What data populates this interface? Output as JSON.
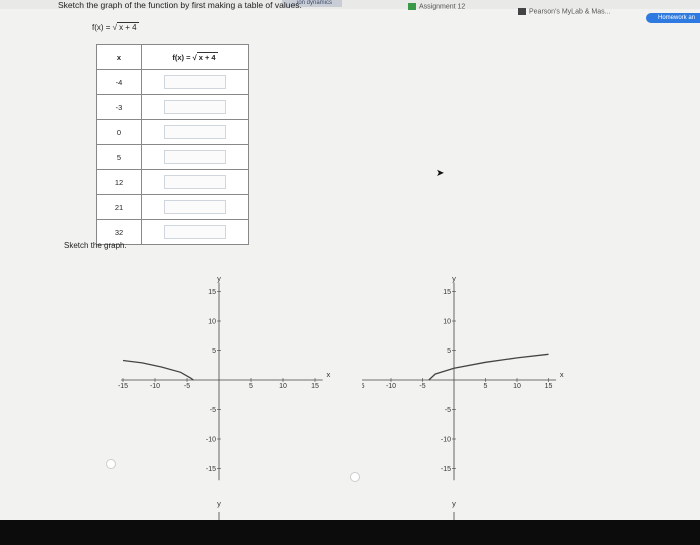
{
  "browser": {
    "tab_fragment": "...ion dynamics",
    "assignment_tab": "Assignment 12",
    "pearson_tab": "Pearson's MyLab & Mas...",
    "homework_tab": "Homework an"
  },
  "question": {
    "title": "Sketch the graph of the function by first making a table of values.",
    "function_lhs": "f(x) = ",
    "function_radicand": "x + 4"
  },
  "table": {
    "headers": {
      "x": "x",
      "fx_lhs": "f(x) = ",
      "fx_radicand": "x + 4"
    },
    "x_values": [
      "-4",
      "-3",
      "0",
      "5",
      "12",
      "21",
      "32"
    ]
  },
  "sketch_label": "Sketch the graph.",
  "graphs": [
    {
      "x_label": "x",
      "y_label": "y",
      "x_ticks": [
        "-15",
        "-10",
        "-5",
        "5",
        "10",
        "15"
      ],
      "y_ticks": [
        "15",
        "10",
        "5",
        "-5",
        "-10",
        "-15"
      ],
      "x_range": [
        -15,
        15
      ],
      "y_range": [
        -15,
        15
      ],
      "curve": [
        [
          -15,
          3.3
        ],
        [
          -12,
          2.9
        ],
        [
          -9,
          2.2
        ],
        [
          -6,
          1.3
        ],
        [
          -4.4,
          0.3
        ],
        [
          -4,
          0
        ]
      ]
    },
    {
      "x_label": "x",
      "y_label": "y",
      "x_ticks": [
        "-15",
        "-10",
        "-5",
        "5",
        "10",
        "15"
      ],
      "y_ticks": [
        "15",
        "10",
        "5",
        "-5",
        "-10",
        "-15"
      ],
      "x_range": [
        -15,
        15
      ],
      "y_range": [
        -15,
        15
      ],
      "curve": [
        [
          -4,
          0
        ],
        [
          -3,
          1
        ],
        [
          0,
          2
        ],
        [
          5,
          3
        ],
        [
          10,
          3.74
        ],
        [
          15,
          4.36
        ]
      ]
    }
  ],
  "bottom_y_label": "y"
}
